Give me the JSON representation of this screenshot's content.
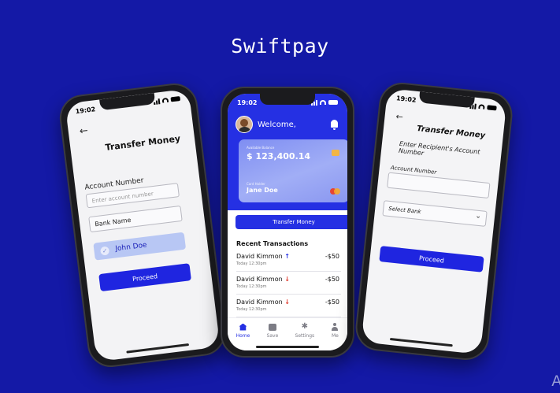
{
  "brand": {
    "title": "Swiftpay",
    "corner_mark": "A"
  },
  "left_screen": {
    "time": "19:02",
    "back": "←",
    "title": "Transfer Money",
    "account_label": "Account Number",
    "account_placeholder": "Enter account number",
    "bank_label": "Bank Name",
    "recipient_name": "John Doe",
    "check": "✓",
    "proceed": "Proceed"
  },
  "center_screen": {
    "time": "19:02",
    "welcome": "Welcome,",
    "card": {
      "balance_label": "Available Balance",
      "balance": "$ 123,400.14",
      "holder_label": "Card Holder",
      "holder": "Jane Doe"
    },
    "transfer_button": "Transfer Money",
    "recent_title": "Recent Transactions",
    "transactions": [
      {
        "name": "David Kimmon",
        "arrow": "↑",
        "time": "Today 12:30pm",
        "amount": "-$50"
      },
      {
        "name": "David Kimmon",
        "arrow": "↓",
        "time": "Today 12:30pm",
        "amount": "-$50"
      },
      {
        "name": "David Kimmon",
        "arrow": "↓",
        "time": "Today 12:30pm",
        "amount": "-$50"
      }
    ],
    "nav": [
      {
        "label": "Home",
        "icon": "home-icon"
      },
      {
        "label": "Save",
        "icon": "save-icon"
      },
      {
        "label": "Settings",
        "icon": "gear-icon",
        "glyph": "✱"
      },
      {
        "label": "Me",
        "icon": "user-icon"
      }
    ]
  },
  "right_screen": {
    "time": "19:02",
    "back": "←",
    "title": "Transfer Money",
    "subtitle": "Enter Recipient's Account Number",
    "account_label": "Account Number",
    "bank_select": "Select Bank",
    "chevron": "⌄",
    "proceed": "Proceed"
  },
  "colors": {
    "background": "#1419a6",
    "primary": "#2530e3",
    "chip": "#b8c7f4",
    "debit": "#e0382b"
  }
}
